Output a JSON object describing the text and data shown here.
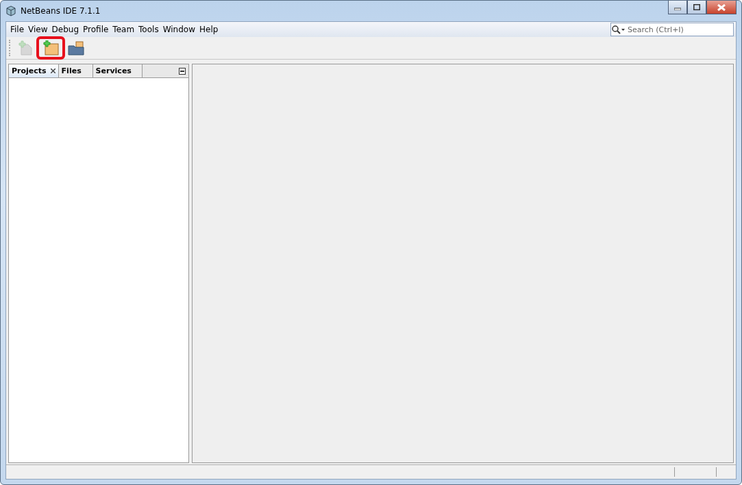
{
  "window": {
    "title": "NetBeans IDE 7.1.1"
  },
  "menu": [
    "File",
    "View",
    "Debug",
    "Profile",
    "Team",
    "Tools",
    "Window",
    "Help"
  ],
  "search": {
    "placeholder": "Search (Ctrl+I)"
  },
  "toolbar": [
    {
      "kind": "new-file",
      "disabled": true,
      "highlighted": false
    },
    {
      "kind": "new-project",
      "disabled": false,
      "highlighted": true
    },
    {
      "kind": "open-project",
      "disabled": false,
      "highlighted": false
    }
  ],
  "tabs": [
    {
      "label": "Projects",
      "selected": true
    },
    {
      "label": "Files",
      "selected": false
    },
    {
      "label": "Services",
      "selected": false
    }
  ]
}
